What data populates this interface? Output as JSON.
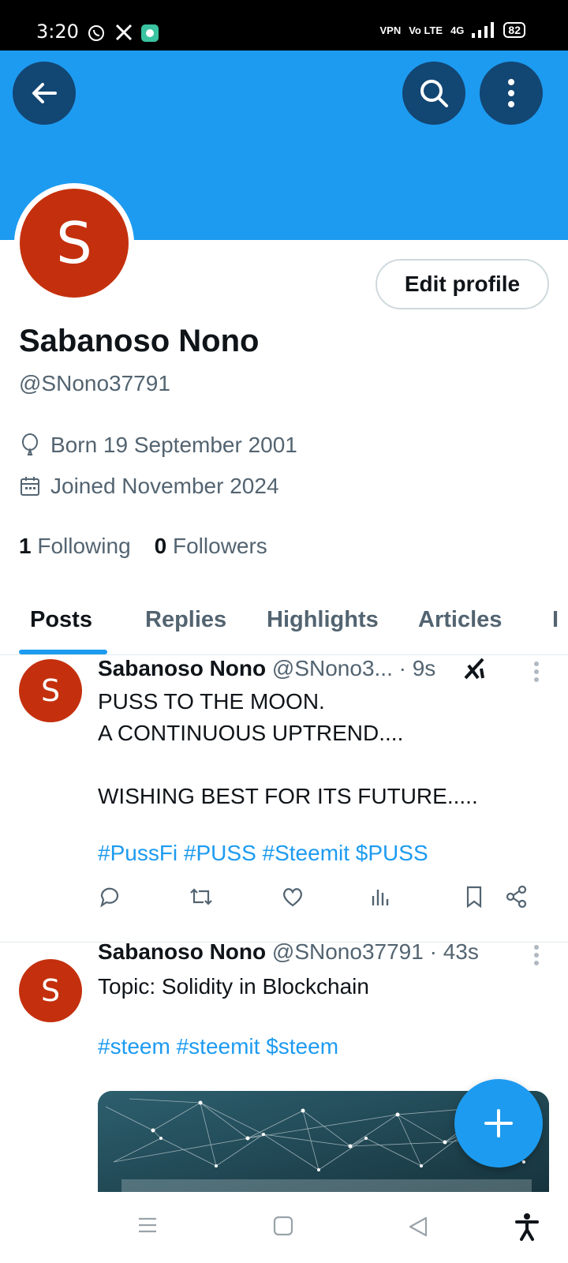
{
  "status_bar": {
    "time": "3:20",
    "battery": "82",
    "icons": [
      "whatsapp-icon",
      "x-logo-icon",
      "app-icon",
      "vpn-icon",
      "volte-icon",
      "4g-signal-icon",
      "signal-icon",
      "battery-icon"
    ],
    "vpn_label": "VPN",
    "volte_label": "Vo LTE",
    "network_label": "4G"
  },
  "header": {
    "banner_color": "#1d9bf0",
    "back_icon": "arrow-left-icon",
    "search_icon": "search-icon",
    "more_icon": "more-vertical-icon"
  },
  "profile": {
    "avatar_letter": "S",
    "avatar_color": "#c4300d",
    "edit_label": "Edit profile",
    "name": "Sabanoso Nono",
    "handle": "@SNono37791",
    "born": "Born 19 September 2001",
    "joined": "Joined November 2024",
    "following_count": "1",
    "following_label": "Following",
    "followers_count": "0",
    "followers_label": "Followers"
  },
  "tabs": [
    {
      "label": "Posts",
      "active": true
    },
    {
      "label": "Replies"
    },
    {
      "label": "Highlights"
    },
    {
      "label": "Articles"
    }
  ],
  "posts": [
    {
      "avatar_letter": "S",
      "name": "Sabanoso Nono",
      "handle_time": "@SNono3... · 9s",
      "lines": [
        "PUSS TO THE MOON.",
        "A CONTINUOUS UPTREND....",
        "",
        "WISHING BEST FOR ITS FUTURE....."
      ],
      "hashtags": "#PussFi #PUSS #Steemit $PUSS"
    },
    {
      "avatar_letter": "S",
      "name": "Sabanoso Nono",
      "handle_time": "@SNono37791 · 43s",
      "lines": [
        "Topic: Solidity in Blockchain"
      ],
      "hashtags": "#steem #steemit $steem"
    }
  ],
  "colors": {
    "accent": "#1d9bf0",
    "secondary_text": "#536471"
  }
}
